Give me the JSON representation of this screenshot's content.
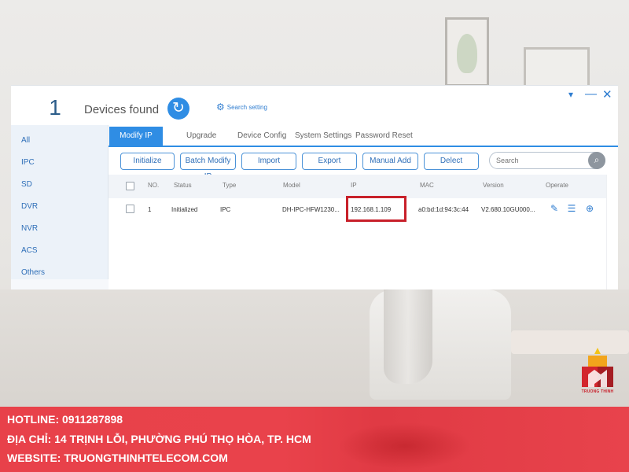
{
  "window": {
    "device_count": "1",
    "devices_found_label": "Devices found",
    "search_setting_label": "Search setting"
  },
  "sidebar": {
    "items": [
      {
        "label": "All"
      },
      {
        "label": "IPC"
      },
      {
        "label": "SD"
      },
      {
        "label": "DVR"
      },
      {
        "label": "NVR"
      },
      {
        "label": "ACS"
      },
      {
        "label": "Others"
      }
    ]
  },
  "tabs": [
    {
      "label": "Modify IP",
      "active": true
    },
    {
      "label": "Upgrade"
    },
    {
      "label": "Device Config"
    },
    {
      "label": "System Settings"
    },
    {
      "label": "Password Reset"
    }
  ],
  "toolbar": {
    "buttons": [
      {
        "label": "Initialize"
      },
      {
        "label": "Batch Modify IP"
      },
      {
        "label": "Import"
      },
      {
        "label": "Export"
      },
      {
        "label": "Manual Add"
      },
      {
        "label": "Delect"
      }
    ],
    "search_placeholder": "Search"
  },
  "table": {
    "headers": [
      "NO.",
      "Status",
      "Type",
      "Model",
      "IP",
      "MAC",
      "Version",
      "Operate"
    ],
    "rows": [
      {
        "no": "1",
        "status": "Initialized",
        "type": "IPC",
        "model": "DH-IPC-HFW1230...",
        "ip": "192.168.1.109",
        "mac": "a0:bd:1d:94:3c:44",
        "version": "V2.680.10GU000..."
      }
    ]
  },
  "logo": {
    "text": "TRUONG THINH"
  },
  "banner": {
    "hotline": "HOTLINE: 0911287898",
    "address": "ĐỊA CHỈ: 14 TRỊNH LỖI, PHƯỜNG PHÚ THỌ HÒA, TP. HCM",
    "website": "WEBSITE: TRUONGTHINHTELECOM.COM"
  },
  "colors": {
    "accent": "#2f8de4",
    "highlight": "#c8202a",
    "banner": "#e8414a"
  }
}
